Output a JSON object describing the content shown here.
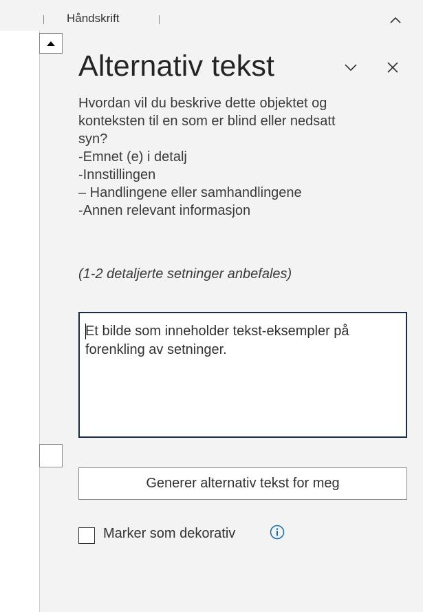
{
  "ribbon": {
    "group_label": "Håndskrift"
  },
  "pane": {
    "title": "Alternativ tekst",
    "description_lines": [
      "Hvordan vil du beskrive dette objektet og",
      "konteksten til en som er blind eller nedsatt",
      "syn?",
      "-Emnet (e) i detalj",
      "-Innstillingen",
      "– Handlingene eller samhandlingene",
      "-Annen relevant informasjon"
    ],
    "hint": "(1-2 detaljerte setninger anbefales)",
    "alt_text_value": "Et bilde som inneholder tekst-eksempler på forenkling av setninger.",
    "generate_button": "Generer alternativ tekst for meg",
    "decorative_label": "Marker som dekorativ",
    "decorative_checked": false
  },
  "icons": {
    "collapse_ribbon": "chevron-up-icon",
    "pane_options": "chevron-down-icon",
    "close_pane": "close-icon",
    "info": "info-icon",
    "scroll_up": "triangle-up-icon"
  },
  "colors": {
    "accent_border": "#1b2a4a",
    "info_blue": "#0f6cbd"
  }
}
